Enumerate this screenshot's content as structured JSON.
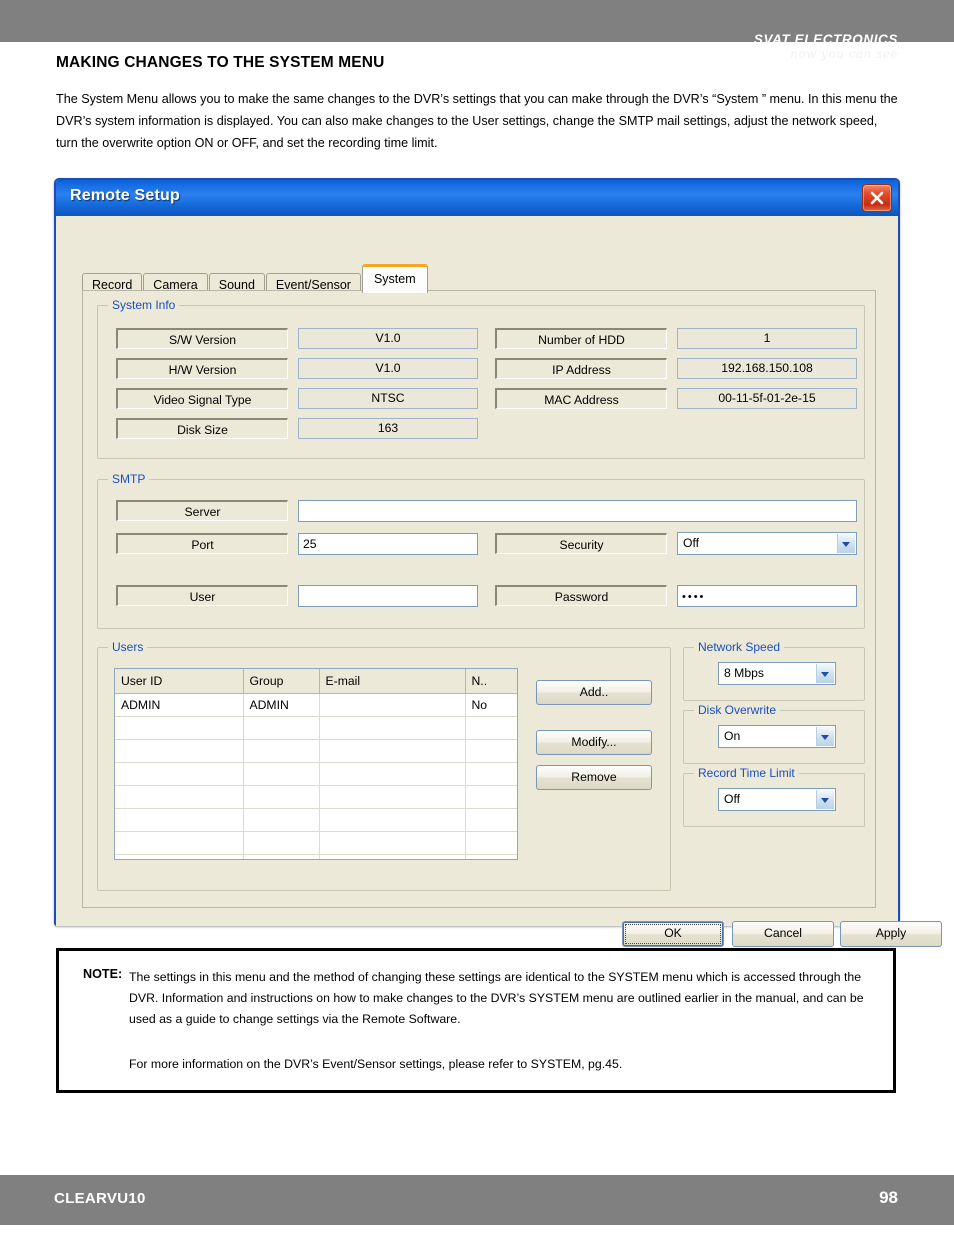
{
  "header": {
    "brand_line1": "SVAT ELECTRONICS",
    "brand_line2": "now you can see"
  },
  "page": {
    "title": "MAKING CHANGES TO THE SYSTEM MENU",
    "intro": "The System Menu allows you to make the same changes to the DVR’s settings that you can make through the DVR’s “System ” menu.  In this menu the DVR’s system information is displayed.  You can also make changes to the User settings, change the SMTP mail settings, adjust the network speed, turn the overwrite option ON or OFF, and set the recording time limit."
  },
  "dialog": {
    "title": "Remote Setup",
    "close_icon": "close-icon",
    "tabs": [
      {
        "label": "Record",
        "active": false
      },
      {
        "label": "Camera",
        "active": false
      },
      {
        "label": "Sound",
        "active": false
      },
      {
        "label": "Event/Sensor",
        "active": false
      },
      {
        "label": "System",
        "active": true
      }
    ],
    "system_info": {
      "legend": "System Info",
      "left_rows": [
        {
          "label": "S/W Version",
          "value": "V1.0"
        },
        {
          "label": "H/W Version",
          "value": "V1.0"
        },
        {
          "label": "Video Signal Type",
          "value": "NTSC"
        },
        {
          "label": "Disk Size",
          "value": "163"
        }
      ],
      "right_rows": [
        {
          "label": "Number of HDD",
          "value": "1"
        },
        {
          "label": "IP Address",
          "value": "192.168.150.108"
        },
        {
          "label": "MAC Address",
          "value": "00-11-5f-01-2e-15"
        }
      ]
    },
    "smtp": {
      "legend": "SMTP",
      "server_label": "Server",
      "server_value": "",
      "port_label": "Port",
      "port_value": "25",
      "security_label": "Security",
      "security_value": "Off",
      "user_label": "User",
      "user_value": "",
      "password_label": "Password",
      "password_value": "••••"
    },
    "users": {
      "legend": "Users",
      "columns": [
        "User ID",
        "Group",
        "E-mail",
        "N.."
      ],
      "rows": [
        [
          "ADMIN",
          "ADMIN",
          "",
          "No"
        ],
        [
          "",
          "",
          "",
          ""
        ],
        [
          "",
          "",
          "",
          ""
        ],
        [
          "",
          "",
          "",
          ""
        ],
        [
          "",
          "",
          "",
          ""
        ],
        [
          "",
          "",
          "",
          ""
        ],
        [
          "",
          "",
          "",
          ""
        ],
        [
          "",
          "",
          "",
          ""
        ]
      ],
      "add_label": "Add..",
      "modify_label": "Modify...",
      "remove_label": "Remove"
    },
    "network_speed": {
      "legend": "Network Speed",
      "value": "8 Mbps"
    },
    "disk_overwrite": {
      "legend": "Disk Overwrite",
      "value": "On"
    },
    "record_time_limit": {
      "legend": "Record Time Limit",
      "value": "Off"
    },
    "footer_buttons": {
      "ok": "OK",
      "cancel": "Cancel",
      "apply": "Apply"
    }
  },
  "note": {
    "label": "NOTE:",
    "paragraph1": "The settings in this menu and the method of changing these settings are identical to the SYSTEM menu which is accessed through the DVR.  Information and instructions on how to make changes to the DVR’s SYSTEM menu are outlined earlier in the manual, and can be used as a guide to change settings via the Remote Software.",
    "paragraph2": "For more information on the DVR’s Event/Sensor settings, please refer to SYSTEM, pg.45."
  },
  "footer": {
    "model": "CLEARVU10",
    "page_number": "98"
  },
  "colors": {
    "bar_gray": "#808080",
    "title_blue": "#1268de",
    "dialog_face": "#ece9d8",
    "legend_blue": "#1a4fbf",
    "active_tab_accent": "#f5a623",
    "close_red": "#c72d11"
  }
}
